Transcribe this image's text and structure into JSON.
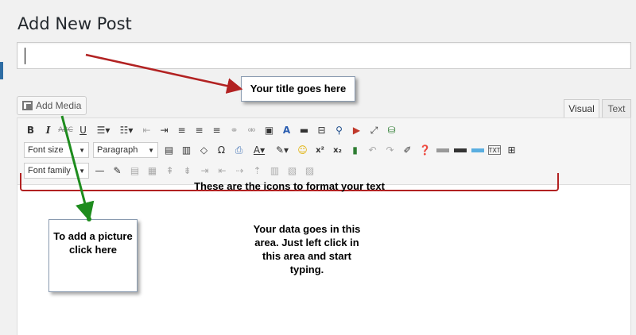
{
  "page": {
    "title": "Add New Post"
  },
  "title_input": {
    "value": ""
  },
  "media_button": {
    "label": "Add Media"
  },
  "tabs": [
    {
      "label": "Visual",
      "active": true
    },
    {
      "label": "Text",
      "active": false
    }
  ],
  "toolbar": {
    "bold": "B",
    "italic": "I",
    "strike": "ABC",
    "underline": "U",
    "font_size": "Font size",
    "paragraph": "Paragraph",
    "font_family": "Font family",
    "superscript": "x²",
    "subscript": "x₂",
    "omega": "Ω",
    "dash": "—"
  },
  "annotations": {
    "title_callout": "Your title goes here",
    "media_callout": "To add a picture click here",
    "toolbar_caption": "These are the icons to format your text",
    "data_area": "Your data goes in this area. Just left click in this area and start typing."
  },
  "colors": {
    "annotation_red": "#b22222",
    "annotation_green": "#1e8c1e",
    "accent_blue": "#2e6da4"
  }
}
